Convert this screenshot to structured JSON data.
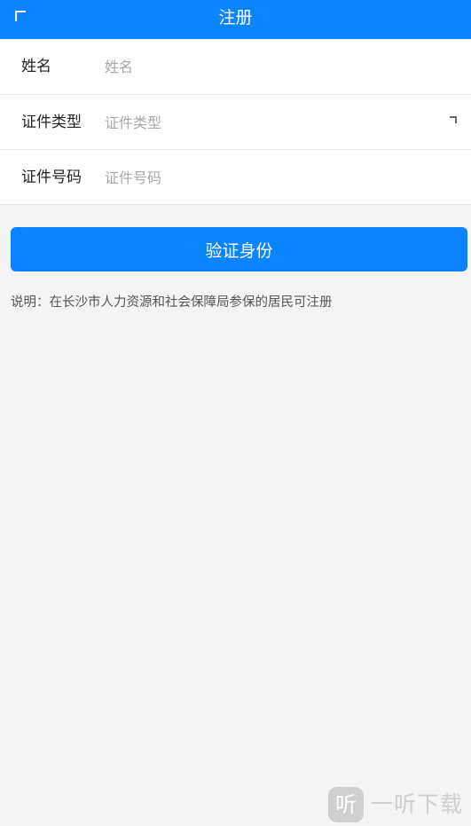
{
  "header": {
    "title": "注册",
    "back_icon": "back-corner-icon"
  },
  "form": {
    "name": {
      "label": "姓名",
      "placeholder": "姓名"
    },
    "id_type": {
      "label": "证件类型",
      "placeholder": "证件类型",
      "icon": "dropdown-icon"
    },
    "id_number": {
      "label": "证件号码",
      "placeholder": "证件号码"
    }
  },
  "verify_button": {
    "label": "验证身份"
  },
  "note": "说明：在长沙市人力资源和社会保障局参保的居民可注册",
  "watermark": {
    "badge": "听",
    "text": "一听下载"
  },
  "colors": {
    "accent": "#0a84ff",
    "background": "#f4f4f4"
  }
}
